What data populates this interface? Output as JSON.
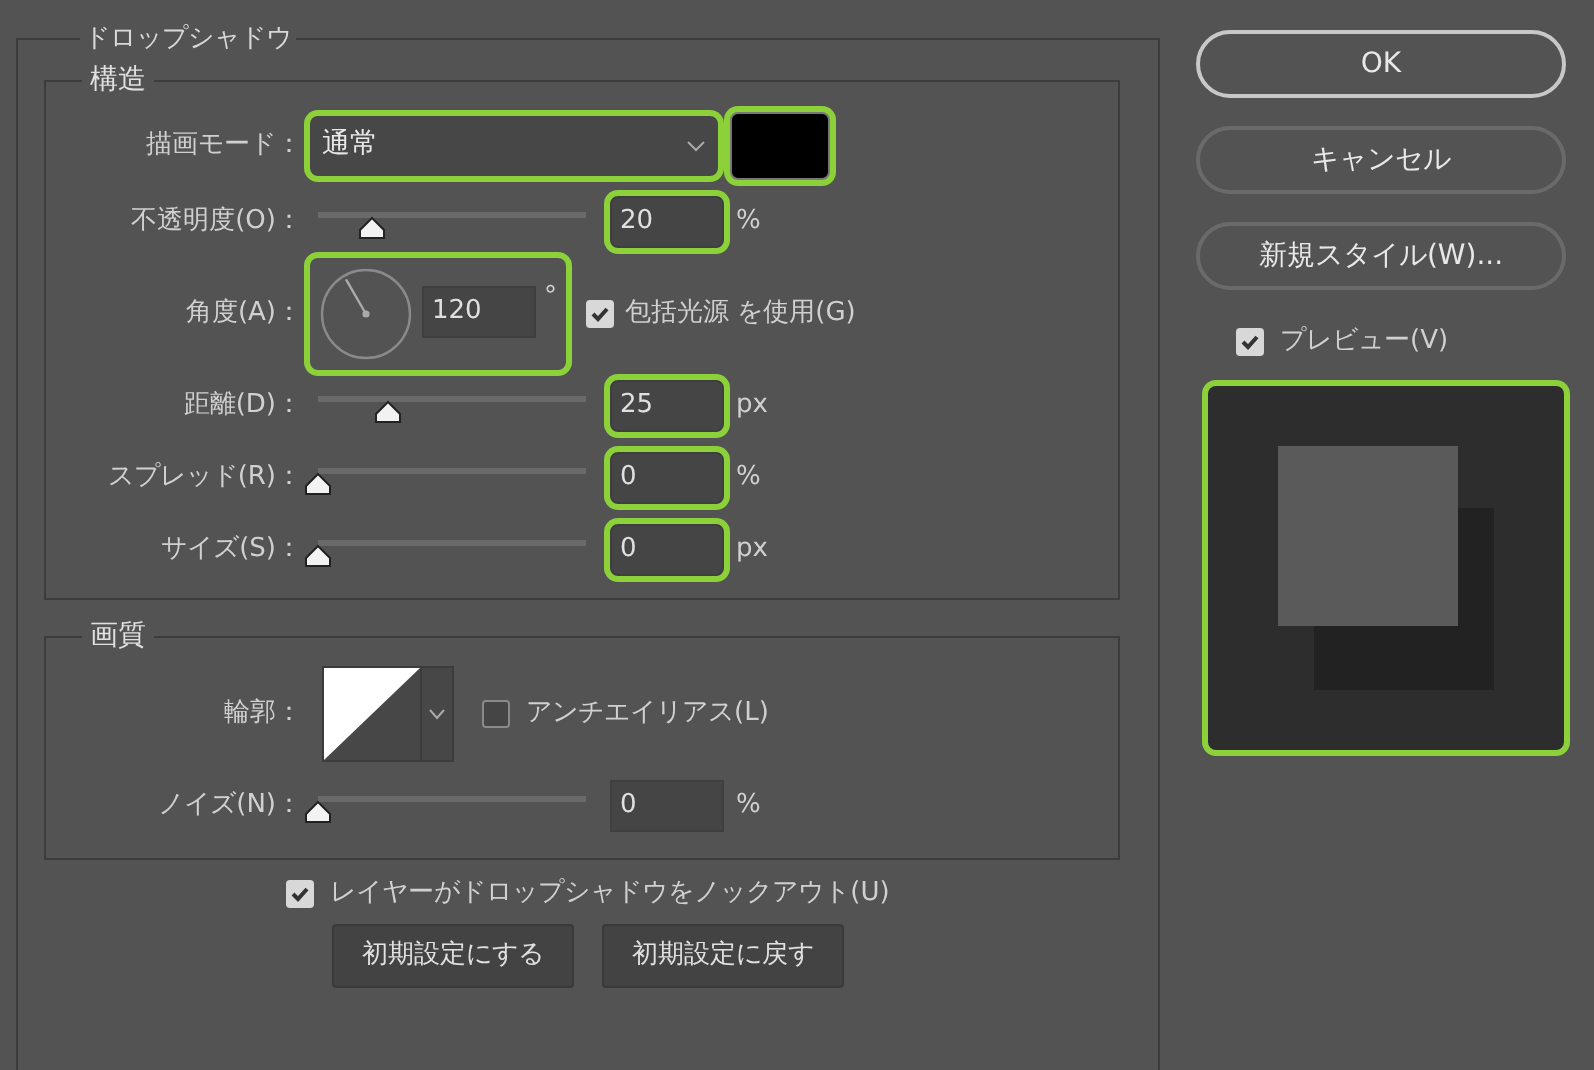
{
  "dialog": {
    "title": "ドロップシャドウ"
  },
  "structure": {
    "title": "構造",
    "blend_mode": {
      "label": "描画モード：",
      "value": "通常",
      "highlighted": true
    },
    "shadow_color": {
      "color": "#000000",
      "highlighted": true
    },
    "opacity": {
      "label": "不透明度(O)：",
      "level": 0.2,
      "value": "20",
      "unit": "%",
      "highlighted": true
    },
    "angle": {
      "label": "角度(A)：",
      "value": "120",
      "unit": "°",
      "highlighted": true
    },
    "global_light": {
      "label": "包括光源 を使用(G)",
      "checked": true
    },
    "distance": {
      "label": "距離(D)：",
      "level": 0.26,
      "value": "25",
      "unit": "px",
      "highlighted": true
    },
    "spread": {
      "label": "スプレッド(R)：",
      "level": 0,
      "value": "0",
      "unit": "%",
      "highlighted": true
    },
    "size": {
      "label": "サイズ(S)：",
      "level": 0,
      "value": "0",
      "unit": "px",
      "highlighted": true
    }
  },
  "quality": {
    "title": "画質",
    "contour": {
      "label": "輪郭："
    },
    "anti_alias": {
      "label": "アンチエイリアス(L)",
      "checked": false
    },
    "noise": {
      "label": "ノイズ(N)：",
      "level": 0,
      "value": "0",
      "unit": "%",
      "highlighted": false
    }
  },
  "knockout": {
    "label": "レイヤーがドロップシャドウをノックアウト(U)",
    "checked": true
  },
  "default_buttons": [
    "初期設定にする",
    "初期設定に戻す"
  ],
  "side_buttons": [
    {
      "label": "OK",
      "primary": true
    },
    {
      "label": "キャンセル",
      "primary": false
    },
    {
      "label": "新規スタイル(W)...",
      "primary": false
    }
  ],
  "preview": {
    "label": "プレビュー(V)",
    "checked": true,
    "highlighted": true
  }
}
